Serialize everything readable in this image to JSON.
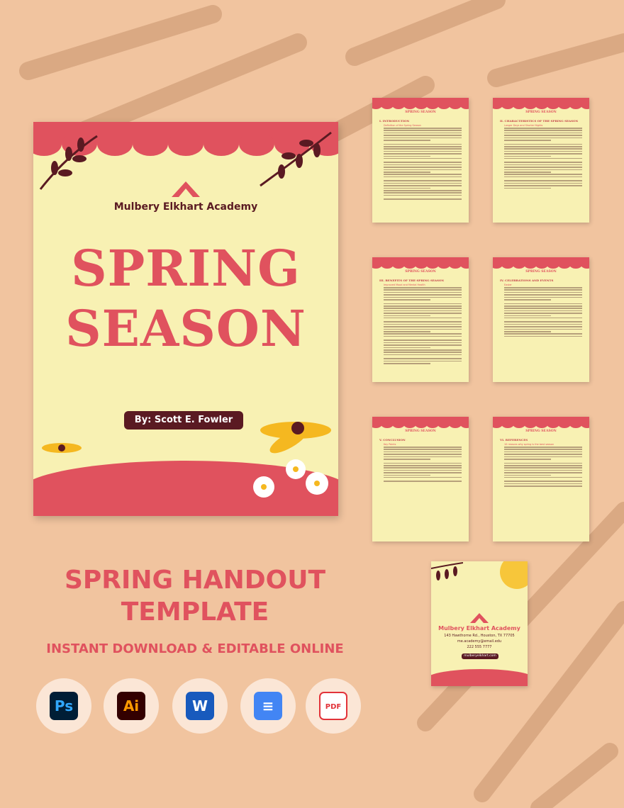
{
  "cover": {
    "academy": "Mulbery Elkhart Academy",
    "title_line1": "SPRING",
    "title_line2": "SEASON",
    "author": "By: Scott E. Fowler"
  },
  "pages": [
    {
      "header": "SPRING SEASON",
      "section": "I. INTRODUCTION",
      "subheading": "Definition of the Spring Season"
    },
    {
      "header": "SPRING SEASON",
      "section": "II. CHARACTERISTICS OF THE SPRING SEASON",
      "subheading": "Longer Days and Shorter Nights"
    },
    {
      "header": "SPRING SEASON",
      "section": "III. BENEFITS OF THE SPRING SEASON",
      "subheading": "Improved Mood and Mental Health"
    },
    {
      "header": "SPRING SEASON",
      "section": "IV. CELEBRATIONS AND EVENTS",
      "subheading": "Easter"
    },
    {
      "header": "SPRING SEASON",
      "section": "V. CONCLUSION",
      "subheading": "Key Points"
    },
    {
      "header": "SPRING SEASON",
      "section": "VI. REFERENCES",
      "subheading": "10 reasons why spring is the best season"
    }
  ],
  "back_cover": {
    "academy": "Mulbery Elkhart Academy",
    "address": "143 Hawthorne Rd., Houston, TX 77705",
    "email": "me.academy@email.edu",
    "phone": "222 555 7777",
    "website": "mulberyelkhart.com"
  },
  "promo": {
    "title_line1": "SPRING HANDOUT",
    "title_line2": "TEMPLATE",
    "subtitle": "INSTANT DOWNLOAD & EDITABLE ONLINE"
  },
  "formats": [
    {
      "icon": "photoshop-icon",
      "label": "Ps",
      "color": "#31a8ff",
      "bg": "#001e36"
    },
    {
      "icon": "illustrator-icon",
      "label": "Ai",
      "color": "#ff9a00",
      "bg": "#330000"
    },
    {
      "icon": "word-icon",
      "label": "W",
      "color": "#ffffff",
      "bg": "#185abd"
    },
    {
      "icon": "google-docs-icon",
      "label": "≡",
      "color": "#ffffff",
      "bg": "#4285f4"
    },
    {
      "icon": "pdf-icon",
      "label": "PDF",
      "color": "#e2333a",
      "bg": "#ffffff"
    }
  ],
  "colors": {
    "accent": "#e0525e",
    "dark": "#5a1a22",
    "paper": "#f8f1b3",
    "background": "#f1c49f"
  }
}
